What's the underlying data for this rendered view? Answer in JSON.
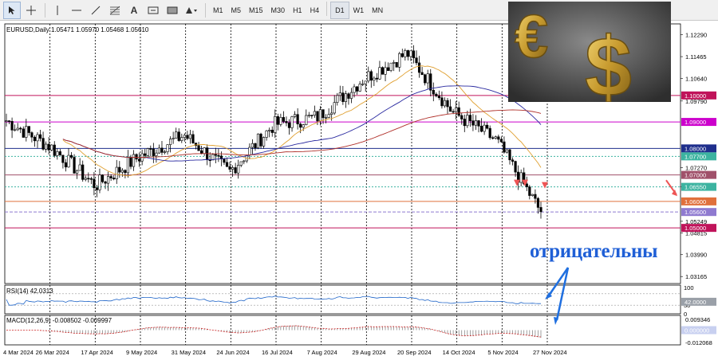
{
  "toolbar": {
    "tools": [
      "cursor-icon",
      "crosshair-icon",
      "vertical-line-icon",
      "horizontal-line-icon",
      "trendline-icon",
      "fibonacci-icon",
      "text-icon",
      "label-icon",
      "rectangle-icon",
      "shapes-icon"
    ],
    "tool_text": {
      "text": "A"
    },
    "timeframes": [
      "M1",
      "M5",
      "M15",
      "M30",
      "H1",
      "H4",
      "D1",
      "W1",
      "MN"
    ],
    "active_timeframe": "D1"
  },
  "chart": {
    "header": "EURUSD,Daily 1.05471 1.05970 1.05468 1.05610",
    "price_ticks": [
      "1.12290",
      "1.11465",
      "1.10640",
      "1.09790",
      "1.07270",
      "1.06550",
      "1.05249",
      "1.04815",
      "1.03990",
      "1.03165"
    ],
    "date_ticks": [
      "4 Mar 2024",
      "26 Mar 2024",
      "17 Apr 2024",
      "9 May 2024",
      "31 May 2024",
      "24 Jun 2024",
      "16 Jul 2024",
      "7 Aug 2024",
      "29 Aug 2024",
      "20 Sep 2024",
      "14 Oct 2024",
      "5 Nov 2024",
      "27 Nov 2024"
    ],
    "levels": [
      {
        "label": "1.10000",
        "color": "#c0135a",
        "style": "solid"
      },
      {
        "label": "1.09000",
        "color": "#cc00cc",
        "style": "solid"
      },
      {
        "label": "1.08000",
        "color": "#1e2e8c",
        "style": "solid"
      },
      {
        "label": "1.07700",
        "color": "#3cb3a0",
        "style": "dotted"
      },
      {
        "label": "1.07000",
        "color": "#a0506a",
        "style": "solid"
      },
      {
        "label": "1.06550",
        "color": "#3cb3a0",
        "style": "dotted"
      },
      {
        "label": "1.06000",
        "color": "#e0703c",
        "style": "solid"
      },
      {
        "label": "1.05600",
        "color": "#8f7ad0",
        "style": "dashed"
      },
      {
        "label": "1.05000",
        "color": "#c0135a",
        "style": "solid"
      }
    ],
    "current_price": "1.05610",
    "annotation": "отрицательны"
  },
  "rsi": {
    "header": "RSI(14) 42.0313",
    "ticks": [
      "100",
      "30",
      "0"
    ],
    "badge": "42.0000"
  },
  "macd": {
    "header": "MACD(12,26,9) -0.008502 -0.009997",
    "ticks": [
      "0.009346",
      "0.000000",
      "-0.012068"
    ]
  },
  "chart_data": {
    "type": "line",
    "title": "EURUSD,Daily",
    "x": [
      "4 Mar 2024",
      "26 Mar 2024",
      "17 Apr 2024",
      "9 May 2024",
      "31 May 2024",
      "24 Jun 2024",
      "16 Jul 2024",
      "7 Aug 2024",
      "29 Aug 2024",
      "20 Sep 2024",
      "14 Oct 2024",
      "5 Nov 2024",
      "27 Nov 2024"
    ],
    "series": [
      {
        "values": [
          1.0905,
          1.0805,
          1.066,
          1.077,
          1.085,
          1.071,
          1.089,
          1.092,
          1.106,
          1.116,
          1.094,
          1.083,
          1.056
        ]
      }
    ],
    "ylim": [
      1.029,
      1.127
    ],
    "grid": true
  }
}
